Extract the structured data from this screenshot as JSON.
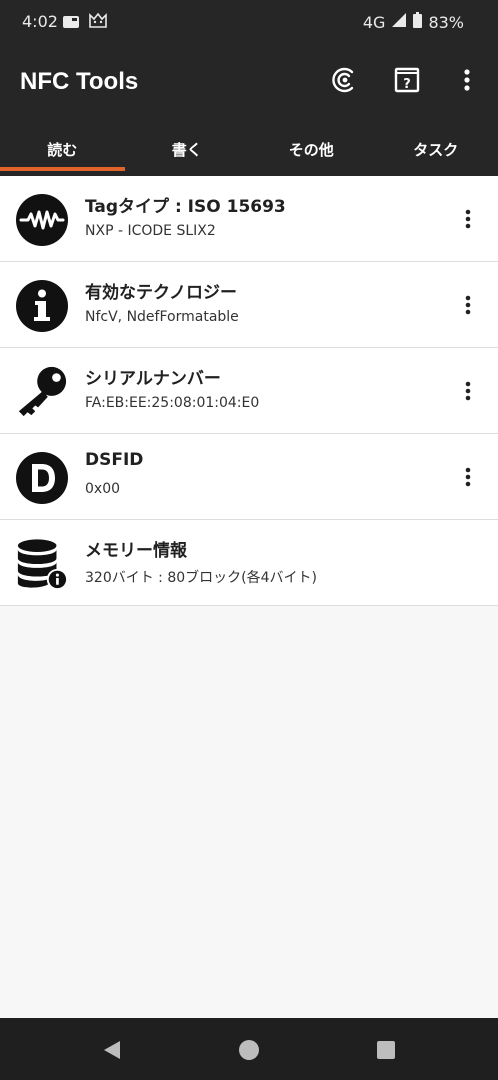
{
  "status_bar": {
    "time": "4:02",
    "network": "4G",
    "battery": "83%"
  },
  "app_bar": {
    "title": "NFC Tools"
  },
  "tabs": [
    {
      "label": "読む",
      "active": true
    },
    {
      "label": "書く",
      "active": false
    },
    {
      "label": "その他",
      "active": false
    },
    {
      "label": "タスク",
      "active": false
    }
  ],
  "items": [
    {
      "title": "Tagタイプ : ISO 15693",
      "subtitle": "NXP - ICODE SLIX2",
      "icon": "waveform-icon"
    },
    {
      "title": "有効なテクノロジー",
      "subtitle": "NfcV, NdefFormatable",
      "icon": "info-icon"
    },
    {
      "title": "シリアルナンバー",
      "subtitle": "FA:EB:EE:25:08:01:04:E0",
      "icon": "key-icon"
    },
    {
      "title": "DSFID",
      "subtitle": "0x00",
      "icon": "d-letter-icon"
    },
    {
      "title": "メモリー情報",
      "subtitle": "320バイト : 80ブロック(各4バイト)",
      "icon": "database-info-icon"
    }
  ],
  "colors": {
    "header_bg": "#262626",
    "accent": "#e0632a",
    "list_bg": "#ffffff",
    "page_bg": "#f7f7f7",
    "nav_bg": "#1f1f1f"
  }
}
